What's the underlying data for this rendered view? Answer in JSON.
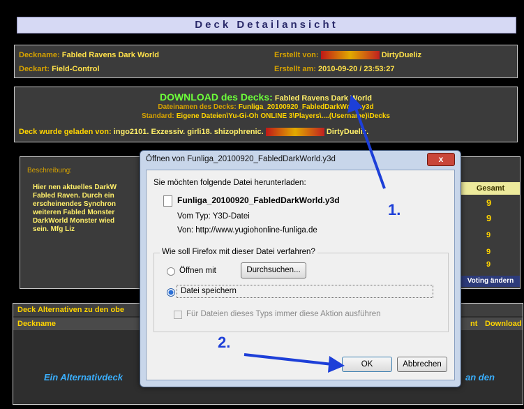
{
  "header": {
    "title": "Deck Detailansicht"
  },
  "deck_info": {
    "name_label": "Deckname:",
    "name_value": "Fabled Ravens Dark World",
    "type_label": "Deckart:",
    "type_value": "Field-Control",
    "created_by_label": "Erstellt von:",
    "created_by_value": "DirtyDueliz",
    "created_at_label": "Erstellt am:",
    "created_at_value": "2010-09-20 / 23:53:27"
  },
  "download": {
    "heading": "DOWNLOAD des Decks:",
    "deck_name": "Fabled Ravens Dark World",
    "filename_label": "Dateinamen des Decks:",
    "filename_value": "Funliga_20100920_FabledDarkWorld.y3d",
    "standard_label": "Standard:",
    "standard_value": "Eigene Dateien\\Yu-Gi-Oh ONLINE 3\\Players\\....(Username)\\Decks",
    "loaded_by_label": "Deck wurde geladen von:",
    "loaded_by_value": "ingo2101. Exzessiv. girli18. shizophrenic.",
    "loaded_by_last": "DirtyDueliz."
  },
  "description": {
    "label": "Beschreibung:",
    "lines": [
      "Hier nen aktuelles DarkW",
      "Fabled Raven. Durch ein",
      "erscheinendes Synchron",
      "weiteren Fabled Monster",
      "DarkWorld Monster wied",
      "sein. Mfg Liz"
    ]
  },
  "voting": {
    "col_header": "Gesamt",
    "values": [
      "9",
      "9",
      "9",
      "9",
      "9"
    ],
    "button": "Voting ändern"
  },
  "alternatives": {
    "title": "Deck Alternativen zu den obe",
    "col_deckname": "Deckname",
    "col_nt": "nt",
    "col_download": "Download",
    "footer_left": "Ein Alternativdeck",
    "footer_right": "an den"
  },
  "dialog": {
    "title": "Öffnen von Funliga_20100920_FabledDarkWorld.y3d",
    "close": "x",
    "intro": "Sie möchten folgende Datei herunterladen:",
    "filename": "Funliga_20100920_FabledDarkWorld.y3d",
    "type_label": "Vom Typ:",
    "type_value": "Y3D-Datei",
    "from_label": "Von:",
    "from_value": "http://www.yugiohonline-funliga.de",
    "question": "Wie soll Firefox mit dieser Datei verfahren?",
    "open_with": "Öffnen mit",
    "browse": "Durchsuchen...",
    "save_file": "Datei speichern",
    "always": "Für Dateien dieses Typs immer diese Aktion ausführen",
    "ok": "OK",
    "cancel": "Abbrechen"
  },
  "annotations": {
    "step1": "1.",
    "step2": "2.",
    "color": "#1d3fd8"
  }
}
